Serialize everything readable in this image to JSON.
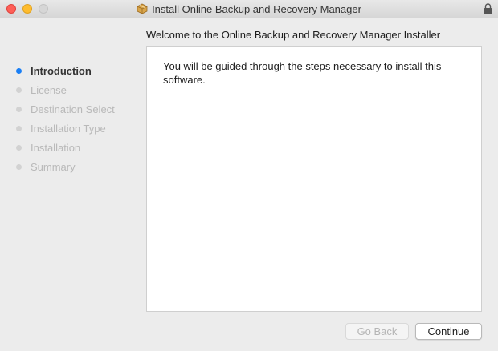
{
  "window": {
    "title": "Install Online Backup and Recovery Manager",
    "icon": "package-icon",
    "lock_icon": "lock-icon"
  },
  "heading": "Welcome to the Online Backup and Recovery Manager Installer",
  "steps": [
    {
      "label": "Introduction",
      "active": true
    },
    {
      "label": "License",
      "active": false
    },
    {
      "label": "Destination Select",
      "active": false
    },
    {
      "label": "Installation Type",
      "active": false
    },
    {
      "label": "Installation",
      "active": false
    },
    {
      "label": "Summary",
      "active": false
    }
  ],
  "content": {
    "text": "You will be guided through the steps necessary to install this software."
  },
  "buttons": {
    "back_label": "Go Back",
    "back_enabled": false,
    "continue_label": "Continue"
  },
  "colors": {
    "active_step": "#1a7ff5",
    "inactive_step": "#d2d2d2"
  }
}
